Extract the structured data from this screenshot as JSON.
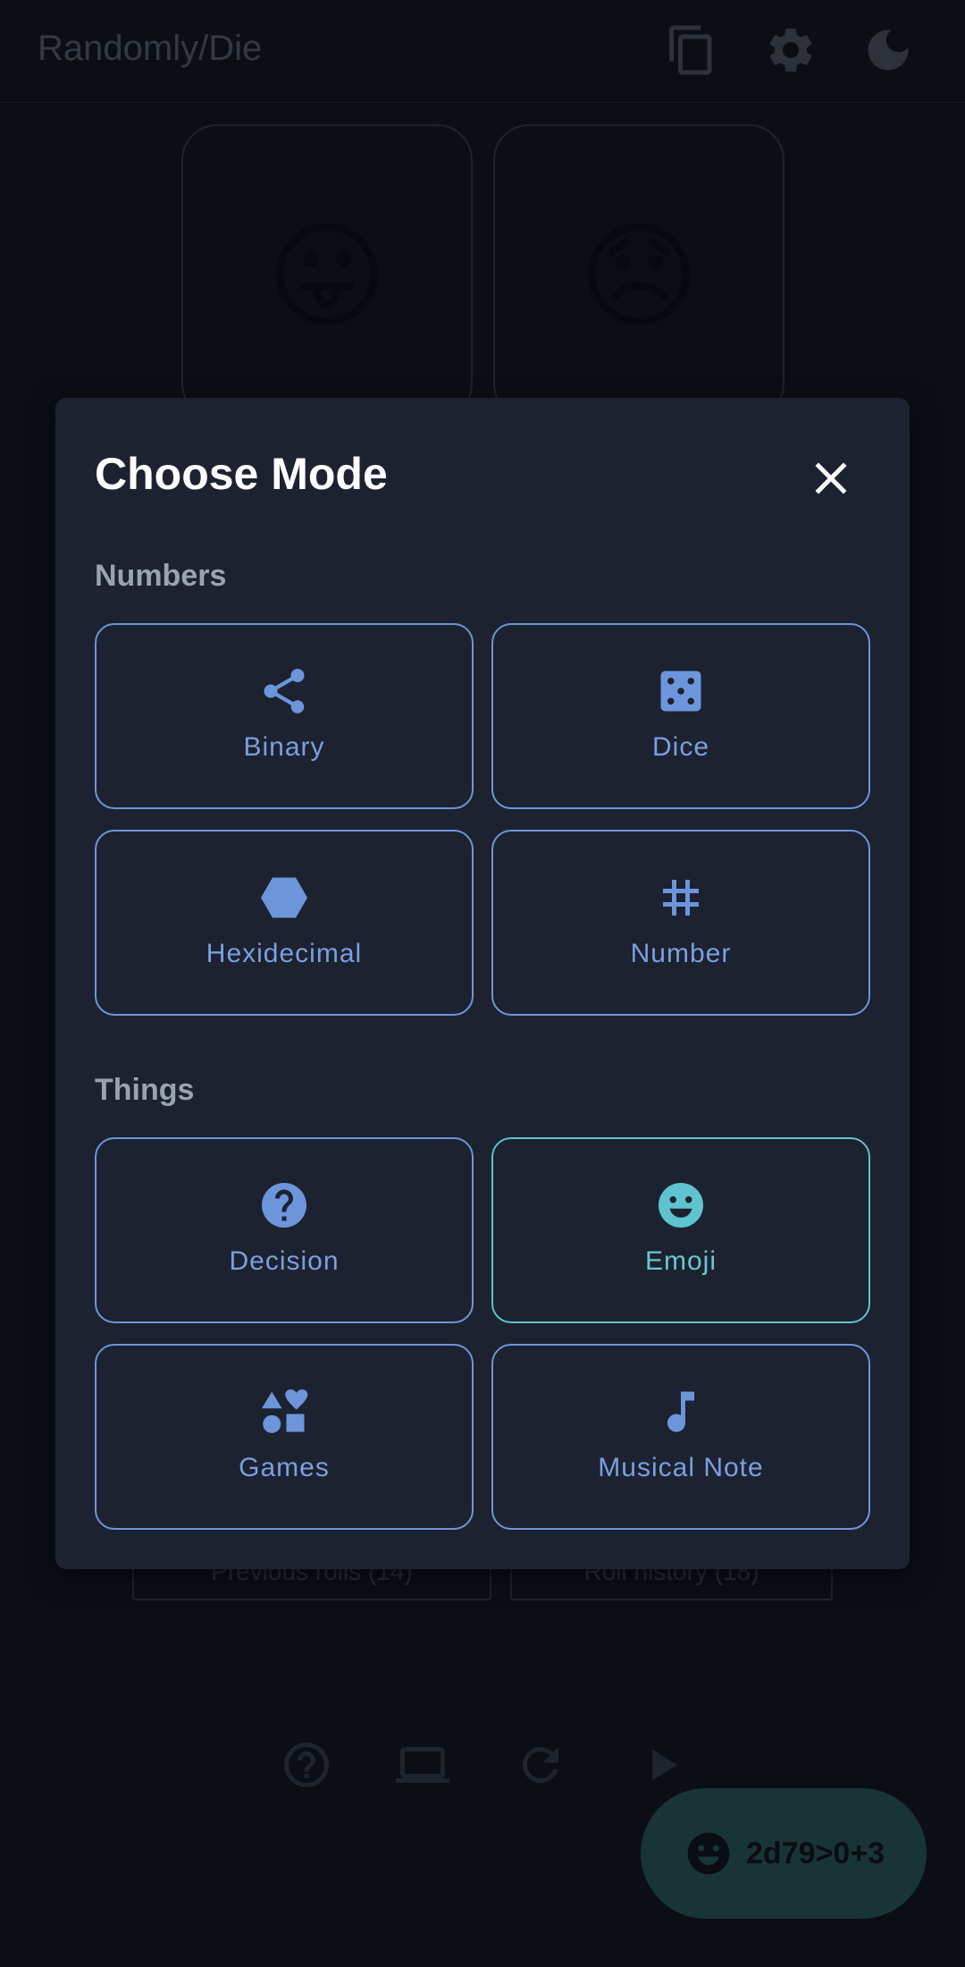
{
  "appbar": {
    "title": "Randomly/Die",
    "icons": [
      "copy-icon",
      "gear-icon",
      "moon-icon"
    ]
  },
  "dice": {
    "faces": [
      "😛",
      "😞"
    ]
  },
  "history": {
    "left_label": "Previous rolls (14)",
    "right_label": "Roll history (18)"
  },
  "bottom_bar": {
    "icons": [
      "help-icon",
      "laptop-icon",
      "refresh-icon",
      "play-icon"
    ]
  },
  "fab": {
    "icon": "emoji-icon",
    "label": "2d79>0+3"
  },
  "dialog": {
    "title": "Choose Mode",
    "close_icon": "close-icon",
    "sections": [
      {
        "label": "Numbers",
        "modes": [
          {
            "label": "Binary",
            "icon": "share-icon"
          },
          {
            "label": "Dice",
            "icon": "dice-icon"
          },
          {
            "label": "Hexidecimal",
            "icon": "hexagon-icon"
          },
          {
            "label": "Number",
            "icon": "hash-icon"
          }
        ]
      },
      {
        "label": "Things",
        "modes": [
          {
            "label": "Decision",
            "icon": "question-icon"
          },
          {
            "label": "Emoji",
            "icon": "emoji-icon",
            "selected": true
          },
          {
            "label": "Games",
            "icon": "shapes-icon"
          },
          {
            "label": "Musical Note",
            "icon": "music-note-icon"
          }
        ]
      }
    ]
  },
  "colors": {
    "background": "#0d1117",
    "dialog_background": "#1c2230",
    "accent_blue": "#6d95db",
    "accent_teal": "#5fc2cf",
    "fab_background": "#234a4a"
  }
}
